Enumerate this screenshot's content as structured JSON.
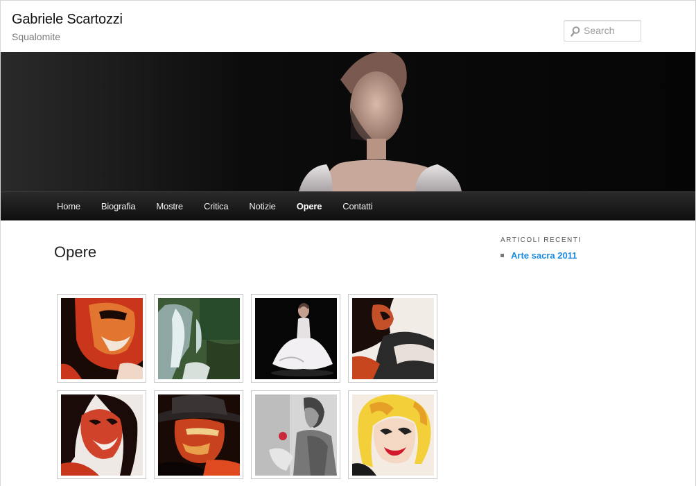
{
  "header": {
    "site_title": "Gabriele Scartozzi",
    "site_description": "Squalomite",
    "search_placeholder": "Search",
    "search_icon": "search-icon"
  },
  "nav": {
    "items": [
      {
        "label": "Home",
        "current": false
      },
      {
        "label": "Biografia",
        "current": false
      },
      {
        "label": "Mostre",
        "current": false
      },
      {
        "label": "Critica",
        "current": false
      },
      {
        "label": "Notizie",
        "current": false
      },
      {
        "label": "Opere",
        "current": true
      },
      {
        "label": "Contatti",
        "current": false
      }
    ]
  },
  "main": {
    "page_title": "Opere"
  },
  "sidebar": {
    "widget_title": "Articoli recenti",
    "recent_posts": [
      "Arte sacra 2011"
    ]
  },
  "gallery": {
    "thumbnails": [
      {
        "subject": "pop-art-smiling-man"
      },
      {
        "subject": "waterfall-landscape"
      },
      {
        "subject": "ballerina-on-black"
      },
      {
        "subject": "pop-art-woman-reclining"
      },
      {
        "subject": "pop-art-smiling-woman"
      },
      {
        "subject": "pop-art-man-with-fedora"
      },
      {
        "subject": "woman-with-flower-grayscale"
      },
      {
        "subject": "pop-art-marilyn"
      }
    ]
  },
  "colors": {
    "link": "#1b8be0",
    "nav_bg": "#1a1a1a",
    "banner_bg": "#050505"
  }
}
